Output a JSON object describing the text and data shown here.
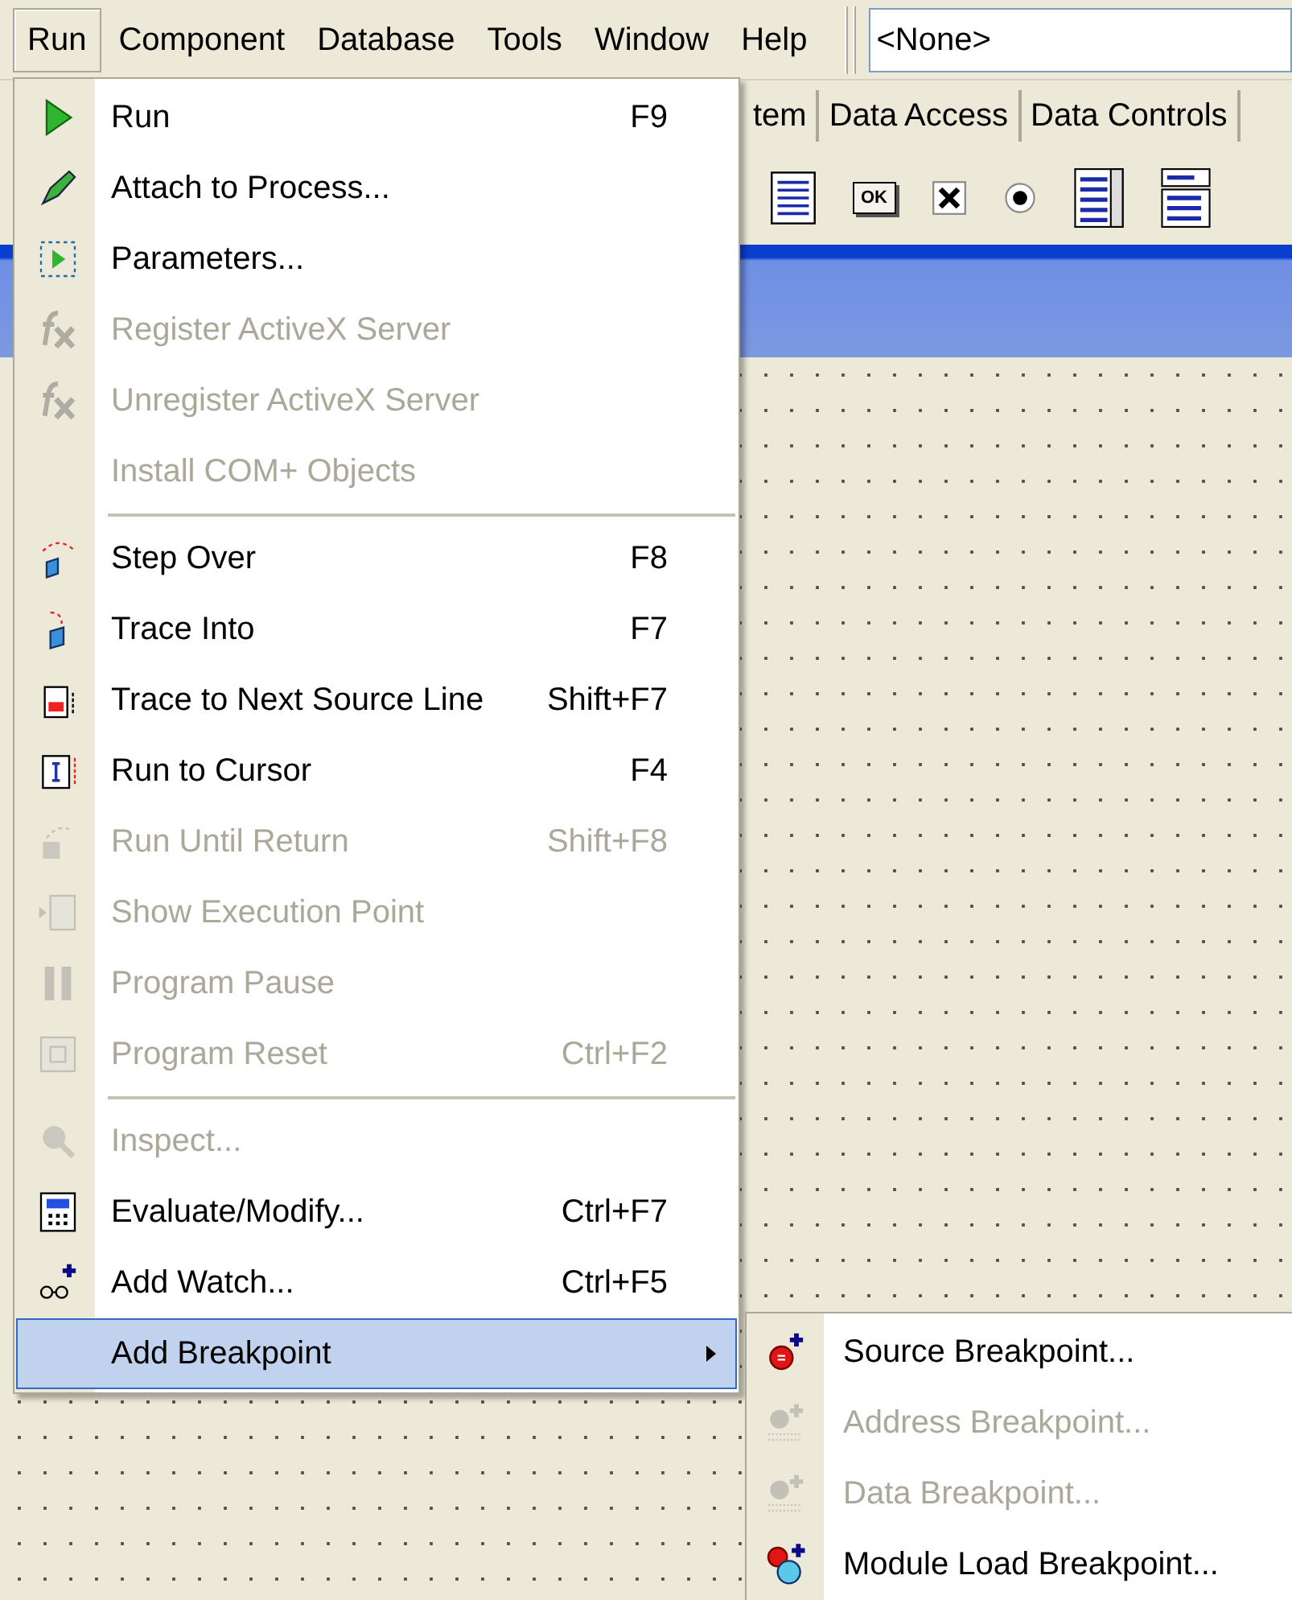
{
  "menubar": {
    "items": [
      {
        "label": "Run",
        "selected": true
      },
      {
        "label": "Component",
        "selected": false
      },
      {
        "label": "Database",
        "selected": false
      },
      {
        "label": "Tools",
        "selected": false
      },
      {
        "label": "Window",
        "selected": false
      },
      {
        "label": "Help",
        "selected": false
      }
    ],
    "combo": {
      "value": "<None>"
    }
  },
  "palette": {
    "tabs": [
      {
        "label": "tem"
      },
      {
        "label": "Data Access"
      },
      {
        "label": "Data Controls"
      }
    ],
    "button_caption": "OK"
  },
  "menu": {
    "items": [
      {
        "kind": "item",
        "label": "Run",
        "shortcut": "F9",
        "disabled": false,
        "selected": false
      },
      {
        "kind": "item",
        "label": "Attach to Process...",
        "disabled": false,
        "selected": false
      },
      {
        "kind": "item",
        "label": "Parameters...",
        "disabled": false,
        "selected": false
      },
      {
        "kind": "item",
        "label": "Register ActiveX Server",
        "disabled": true,
        "selected": false
      },
      {
        "kind": "item",
        "label": "Unregister ActiveX Server",
        "disabled": true,
        "selected": false
      },
      {
        "kind": "item",
        "label": "Install COM+ Objects",
        "disabled": true,
        "selected": false
      },
      {
        "kind": "separator"
      },
      {
        "kind": "item",
        "label": "Step Over",
        "shortcut": "F8",
        "disabled": false,
        "selected": false
      },
      {
        "kind": "item",
        "label": "Trace Into",
        "shortcut": "F7",
        "disabled": false,
        "selected": false
      },
      {
        "kind": "item",
        "label": "Trace to Next Source Line",
        "shortcut": "Shift+F7",
        "disabled": false,
        "selected": false
      },
      {
        "kind": "item",
        "label": "Run to Cursor",
        "shortcut": "F4",
        "disabled": false,
        "selected": false
      },
      {
        "kind": "item",
        "label": "Run Until Return",
        "shortcut": "Shift+F8",
        "disabled": true,
        "selected": false
      },
      {
        "kind": "item",
        "label": "Show Execution Point",
        "disabled": true,
        "selected": false
      },
      {
        "kind": "item",
        "label": "Program Pause",
        "disabled": true,
        "selected": false
      },
      {
        "kind": "item",
        "label": "Program Reset",
        "shortcut": "Ctrl+F2",
        "disabled": true,
        "selected": false
      },
      {
        "kind": "separator"
      },
      {
        "kind": "item",
        "label": "Inspect...",
        "disabled": true,
        "selected": false
      },
      {
        "kind": "item",
        "label": "Evaluate/Modify...",
        "shortcut": "Ctrl+F7",
        "disabled": false,
        "selected": false
      },
      {
        "kind": "item",
        "label": "Add Watch...",
        "shortcut": "Ctrl+F5",
        "disabled": false,
        "selected": false
      },
      {
        "kind": "submenu",
        "label": "Add Breakpoint",
        "disabled": false,
        "selected": true
      }
    ]
  },
  "submenu": {
    "items": [
      {
        "label": "Source Breakpoint...",
        "disabled": false
      },
      {
        "label": "Address Breakpoint...",
        "disabled": true
      },
      {
        "label": "Data Breakpoint...",
        "disabled": true
      },
      {
        "label": "Module Load Breakpoint...",
        "disabled": false
      }
    ]
  }
}
